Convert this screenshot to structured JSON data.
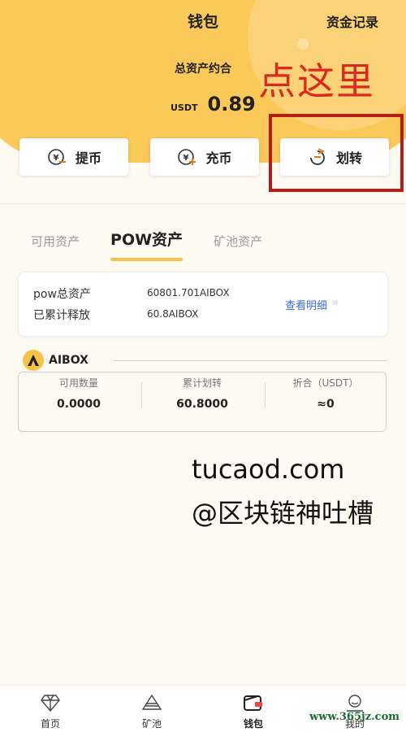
{
  "header": {
    "title": "钱包",
    "records_link": "资金记录",
    "total_label": "总资产约合",
    "balance_unit": "USDT",
    "balance_value": "0.89"
  },
  "annotation": {
    "text": "点这里",
    "color": "#d82a1f"
  },
  "actions": [
    {
      "label": "提币",
      "icon": "withdraw-icon"
    },
    {
      "label": "充币",
      "icon": "deposit-icon"
    },
    {
      "label": "划转",
      "icon": "transfer-icon"
    }
  ],
  "tabs": [
    {
      "label": "可用资产",
      "active": false
    },
    {
      "label": "POW资产",
      "active": true
    },
    {
      "label": "矿池资产",
      "active": false
    }
  ],
  "summary": {
    "total_label": "pow总资产",
    "total_value": "60801.701AIBOX",
    "released_label": "已累计释放",
    "released_value": "60.8AIBOX",
    "detail_link": "查看明细",
    "detail_chevrons": "»"
  },
  "aibox": {
    "name": "AIBOX",
    "logo_letter": "A",
    "columns": [
      {
        "label": "可用数量",
        "value": "0.0000"
      },
      {
        "label": "累计划转",
        "value": "60.8000"
      },
      {
        "label": "折合（USDT）",
        "value": "≈0"
      }
    ]
  },
  "watermark": {
    "domain": "tucaod.com",
    "handle": "@区块链神吐槽",
    "site": "www.365jz.com"
  },
  "bottom_nav": [
    {
      "label": "首页",
      "icon": "diamond-icon",
      "active": false
    },
    {
      "label": "矿池",
      "icon": "mountain-icon",
      "active": false
    },
    {
      "label": "钱包",
      "icon": "wallet-icon",
      "active": true
    },
    {
      "label": "我的",
      "icon": "user-icon",
      "active": false
    }
  ],
  "colors": {
    "accent": "#f6c34a",
    "header_bg": "#fbc85a",
    "page_bg": "#fdfaf1",
    "link": "#3b6bd8",
    "highlight_border": "#b31d1a"
  }
}
